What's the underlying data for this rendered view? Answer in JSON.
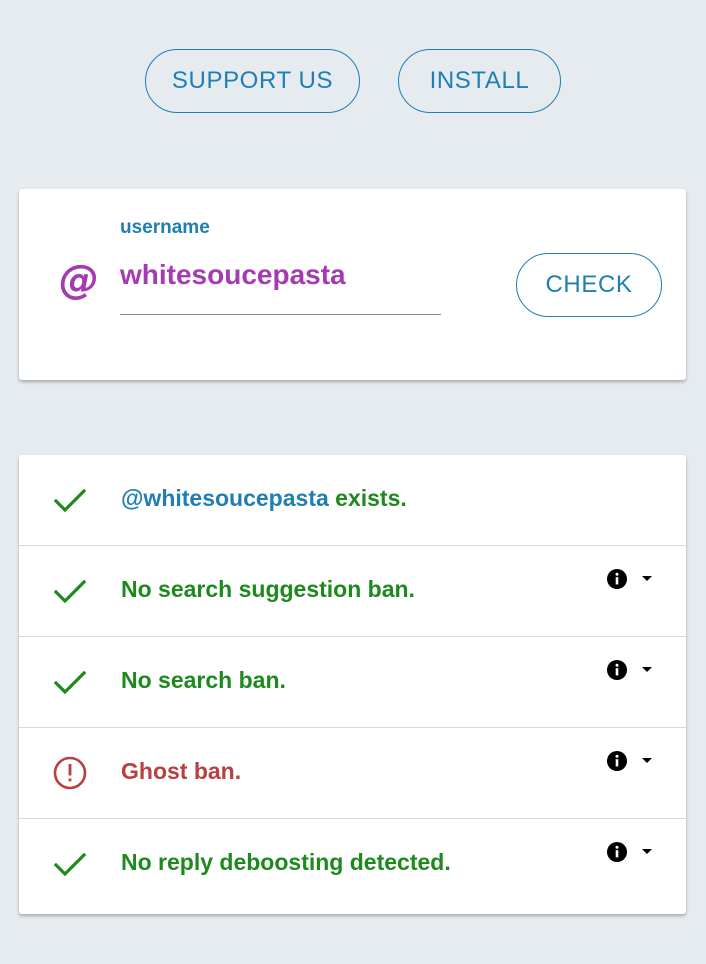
{
  "actions": {
    "support_label": "SUPPORT US",
    "install_label": "INSTALL"
  },
  "search": {
    "prefix_icon": "at-sign-icon",
    "prefix_symbol": "@",
    "label": "username",
    "value": "whitesoucepasta",
    "check_label": "CHECK"
  },
  "results": {
    "exists": {
      "status": "ok",
      "icon": "checkmark-icon",
      "handle": "@whitesoucepasta",
      "text": " exists."
    },
    "items": [
      {
        "status": "ok",
        "icon": "checkmark-icon",
        "text": "No search suggestion ban.",
        "has_info": true
      },
      {
        "status": "ok",
        "icon": "checkmark-icon",
        "text": "No search ban.",
        "has_info": true
      },
      {
        "status": "error",
        "icon": "alert-circle-icon",
        "text": "Ghost ban.",
        "has_info": true
      },
      {
        "status": "ok",
        "icon": "checkmark-icon",
        "text": "No reply deboosting detected.",
        "has_info": true
      }
    ]
  },
  "colors": {
    "accent": "#1f7fb3",
    "username": "#a53bb1",
    "ok": "#1e8a1e",
    "error": "#b94040",
    "background": "#e6ebef"
  }
}
